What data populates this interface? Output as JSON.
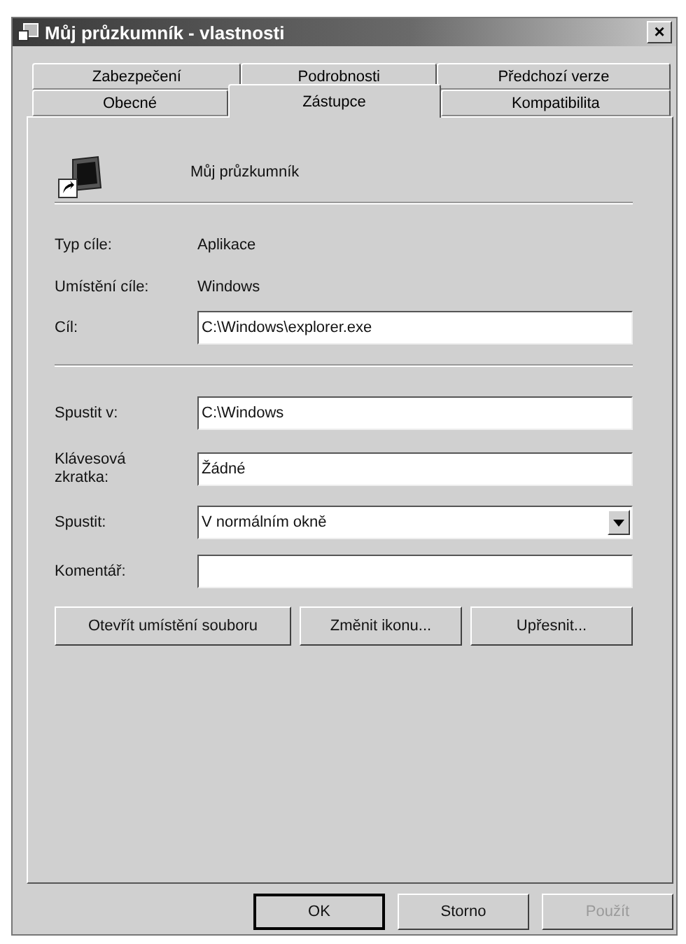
{
  "window": {
    "title": "Můj průzkumník - vlastnosti",
    "close": "×"
  },
  "tab_rows": [
    [
      {
        "label": "Zabezpečení",
        "selected": false
      },
      {
        "label": "Podrobnosti",
        "selected": false
      },
      {
        "label": "Předchozí verze",
        "selected": false
      }
    ],
    [
      {
        "label": "Obecné",
        "selected": false
      },
      {
        "label": "Zástupce",
        "selected": true
      },
      {
        "label": "Kompatibilita",
        "selected": false
      }
    ]
  ],
  "shortcut_name": "Můj průzkumník",
  "info_rows": [
    {
      "label": "Typ cíle:",
      "value": "Aplikace"
    },
    {
      "label": "Umístění cíle:",
      "value": "Windows"
    }
  ],
  "target": {
    "label": "Cíl:",
    "value": "C:\\Windows\\explorer.exe"
  },
  "fields": [
    {
      "kind": "text",
      "label": "Spustit v:",
      "value": "C:\\Windows"
    },
    {
      "kind": "text",
      "label": "Klávesová zkratka:",
      "value": "Žádné"
    },
    {
      "kind": "dropdown",
      "label": "Spustit:",
      "value": "V normálním okně"
    },
    {
      "kind": "text",
      "label": "Komentář:"
    }
  ],
  "action_buttons": [
    "Otevřít umístění souboru",
    "Změnit ikonu...",
    "Upřesnit..."
  ],
  "dialog_buttons": [
    {
      "label": "OK",
      "disabled": false,
      "default": true
    },
    {
      "label": "Storno",
      "disabled": false,
      "default": false
    },
    {
      "label": "Použít",
      "disabled": true,
      "default": false
    }
  ]
}
